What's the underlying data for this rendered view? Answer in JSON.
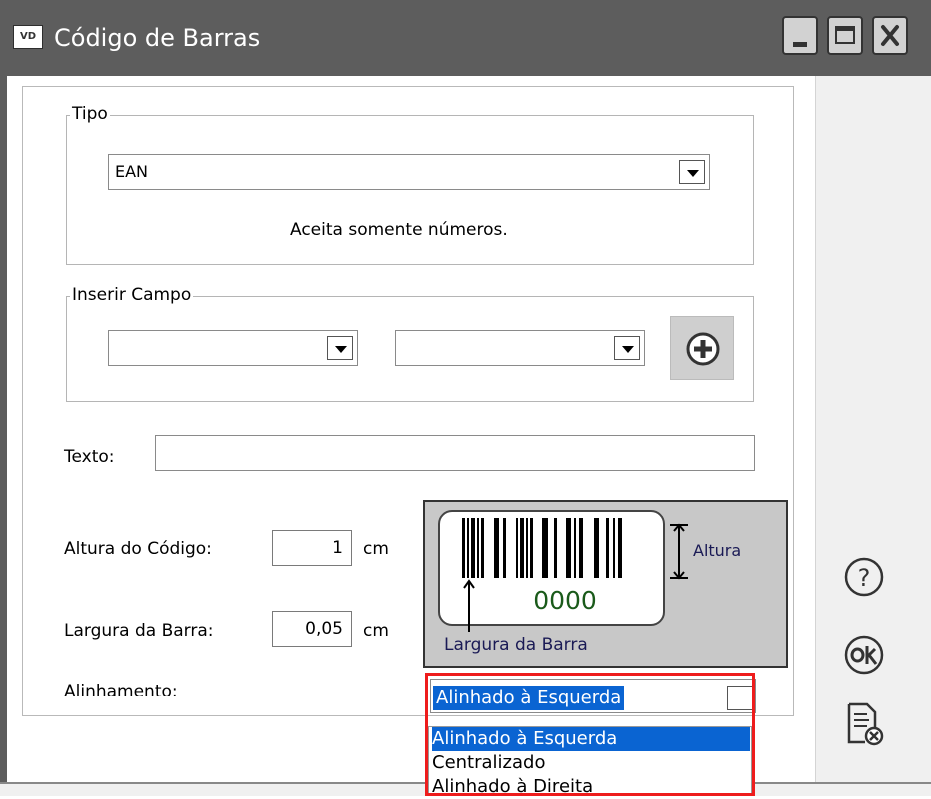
{
  "window": {
    "icon_text": "VD",
    "title": "Código de Barras"
  },
  "tipo": {
    "legend": "Tipo",
    "selected": "EAN",
    "hint": "Aceita somente números."
  },
  "inserir_campo": {
    "legend": "Inserir Campo",
    "field1": "",
    "field2": ""
  },
  "texto": {
    "label": "Texto:",
    "value": ""
  },
  "altura": {
    "label": "Altura do Código:",
    "value": "1",
    "unit": "cm"
  },
  "largura": {
    "label": "Largura da Barra:",
    "value": "0,05",
    "unit": "cm"
  },
  "alinhamento": {
    "label": "Alinhamento:",
    "selected": "Alinhado à Esquerda",
    "options": [
      "Alinhado à Esquerda",
      "Centralizado",
      "Alinhado à Direita"
    ]
  },
  "preview": {
    "digits": "0000",
    "height_label": "Altura",
    "width_label": "Largura da Barra"
  },
  "colors": {
    "titlebar": "#5d5d5d",
    "selection": "#0a64d2",
    "highlight": "#ee1c1c"
  },
  "icons": [
    "minimize-icon",
    "maximize-icon",
    "close-icon",
    "plus-circle-icon",
    "help-icon",
    "ok-icon",
    "cancel-document-icon"
  ]
}
